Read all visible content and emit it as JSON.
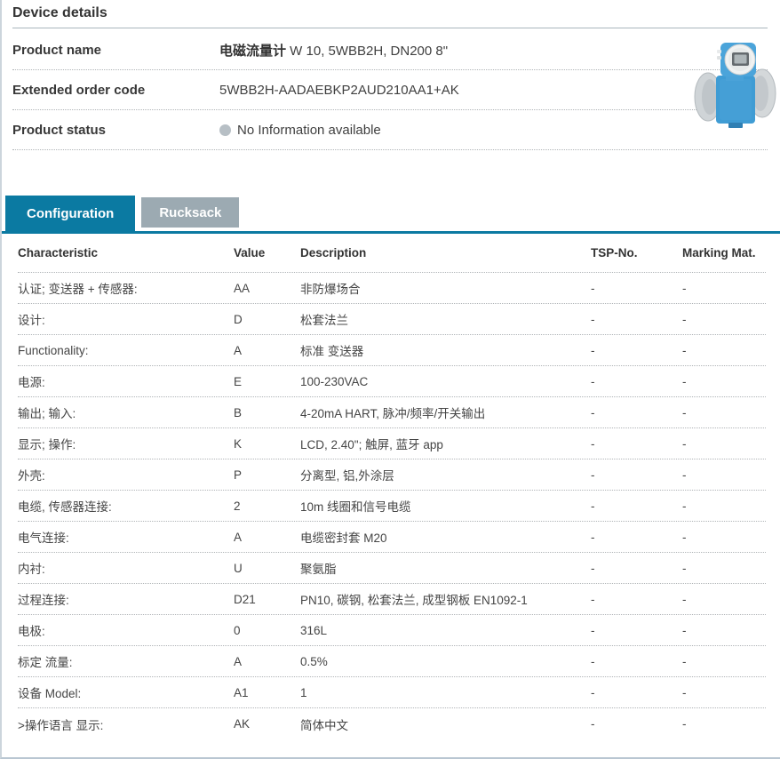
{
  "header": {
    "title": "Device details",
    "product_name_label": "Product name",
    "product_name_bold": "电磁流量计",
    "product_name_rest": " W 10, 5WBB2H, DN200 8\"",
    "order_code_label": "Extended order code",
    "order_code_value": "5WBB2H-AADAEBKP2AUD210AA1+AK",
    "status_label": "Product status",
    "status_value": "No Information available"
  },
  "product_image": {
    "alt": "electromagnetic-flowmeter"
  },
  "tabs": [
    {
      "label": "Configuration",
      "active": true
    },
    {
      "label": "Rucksack",
      "active": false
    }
  ],
  "table": {
    "columns": [
      "Characteristic",
      "Value",
      "Description",
      "TSP-No.",
      "Marking Mat."
    ],
    "rows": [
      {
        "characteristic": "认证; 变送器 + 传感器:",
        "value": "AA",
        "description": "非防爆场合",
        "tsp": "-",
        "marking": "-"
      },
      {
        "characteristic": "设计:",
        "value": "D",
        "description": "松套法兰",
        "tsp": "-",
        "marking": "-"
      },
      {
        "characteristic": "Functionality:",
        "value": "A",
        "description": "标准 变送器",
        "tsp": "-",
        "marking": "-"
      },
      {
        "characteristic": "电源:",
        "value": "E",
        "description": "100-230VAC",
        "tsp": "-",
        "marking": "-"
      },
      {
        "characteristic": "输出; 输入:",
        "value": "B",
        "description": "4-20mA HART, 脉冲/频率/开关输出",
        "tsp": "-",
        "marking": "-"
      },
      {
        "characteristic": "显示; 操作:",
        "value": "K",
        "description": "LCD, 2.40\"; 触屏, 蓝牙 app",
        "tsp": "-",
        "marking": "-"
      },
      {
        "characteristic": "外壳:",
        "value": "P",
        "description": "分离型, 铝,外涂层",
        "tsp": "-",
        "marking": "-"
      },
      {
        "characteristic": "电缆, 传感器连接:",
        "value": "2",
        "description": "10m 线圈和信号电缆",
        "tsp": "-",
        "marking": "-"
      },
      {
        "characteristic": "电气连接:",
        "value": "A",
        "description": "电缆密封套 M20",
        "tsp": "-",
        "marking": "-"
      },
      {
        "characteristic": "内衬:",
        "value": "U",
        "description": "聚氨脂",
        "tsp": "-",
        "marking": "-"
      },
      {
        "characteristic": "过程连接:",
        "value": "D21",
        "description": "PN10, 碳钢, 松套法兰, 成型钢板 EN1092-1",
        "tsp": "-",
        "marking": "-"
      },
      {
        "characteristic": "电极:",
        "value": "0",
        "description": "316L",
        "tsp": "-",
        "marking": "-"
      },
      {
        "characteristic": "标定 流量:",
        "value": "A",
        "description": "0.5%",
        "tsp": "-",
        "marking": "-"
      },
      {
        "characteristic": "设备 Model:",
        "value": "A1",
        "description": "1",
        "tsp": "-",
        "marking": "-"
      },
      {
        "characteristic": ">操作语言 显示:",
        "value": "AK",
        "description": "简体中文",
        "tsp": "-",
        "marking": "-"
      }
    ]
  },
  "colors": {
    "accent_teal": "#0b7aa2",
    "tab_inactive_gray": "#9caab2",
    "status_dot_gray": "#b7bfc5",
    "device_blue": "#459fd6",
    "border_light": "#ccd5dc",
    "dotted_line": "#b0b4b7"
  }
}
